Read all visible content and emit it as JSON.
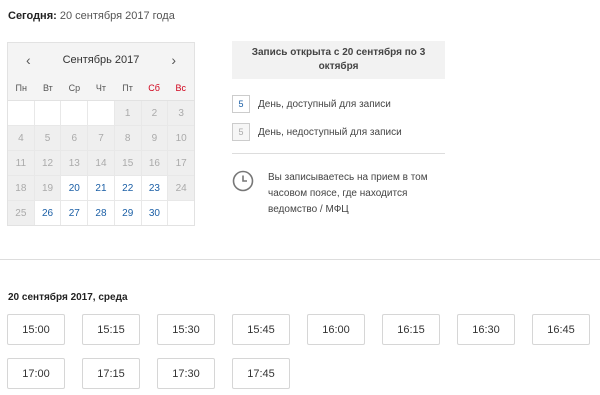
{
  "header": {
    "label": "Сегодня:",
    "date": "20 сентября 2017 года"
  },
  "calendar": {
    "prev_icon": "‹",
    "next_icon": "›",
    "month": "Сентябрь 2017",
    "weekdays": [
      "Пн",
      "Вт",
      "Ср",
      "Чт",
      "Пт",
      "Сб",
      "Вс"
    ],
    "weekend_color": "#d0021b",
    "available_color": "#1b5fa6",
    "days": [
      {
        "d": "",
        "s": "empty"
      },
      {
        "d": "",
        "s": "empty"
      },
      {
        "d": "",
        "s": "empty"
      },
      {
        "d": "",
        "s": "empty"
      },
      {
        "d": "1",
        "s": "na"
      },
      {
        "d": "2",
        "s": "na"
      },
      {
        "d": "3",
        "s": "na"
      },
      {
        "d": "4",
        "s": "na"
      },
      {
        "d": "5",
        "s": "na"
      },
      {
        "d": "6",
        "s": "na"
      },
      {
        "d": "7",
        "s": "na"
      },
      {
        "d": "8",
        "s": "na"
      },
      {
        "d": "9",
        "s": "na"
      },
      {
        "d": "10",
        "s": "na"
      },
      {
        "d": "11",
        "s": "na"
      },
      {
        "d": "12",
        "s": "na"
      },
      {
        "d": "13",
        "s": "na"
      },
      {
        "d": "14",
        "s": "na"
      },
      {
        "d": "15",
        "s": "na"
      },
      {
        "d": "16",
        "s": "na"
      },
      {
        "d": "17",
        "s": "na"
      },
      {
        "d": "18",
        "s": "na"
      },
      {
        "d": "19",
        "s": "na"
      },
      {
        "d": "20",
        "s": "av"
      },
      {
        "d": "21",
        "s": "av"
      },
      {
        "d": "22",
        "s": "av"
      },
      {
        "d": "23",
        "s": "av"
      },
      {
        "d": "24",
        "s": "na"
      },
      {
        "d": "25",
        "s": "na"
      },
      {
        "d": "26",
        "s": "av"
      },
      {
        "d": "27",
        "s": "av"
      },
      {
        "d": "28",
        "s": "av"
      },
      {
        "d": "29",
        "s": "av"
      },
      {
        "d": "30",
        "s": "av"
      },
      {
        "d": "",
        "s": "empty"
      }
    ]
  },
  "notice": "Запись открыта с 20 сентября по 3 октября",
  "legend": {
    "available_num": "5",
    "available_label": "День, доступный для записи",
    "unavailable_num": "5",
    "unavailable_label": "День, недоступный для записи"
  },
  "timezone": {
    "icon": "clock-icon",
    "text": "Вы записываетесь на прием в том часовом поясе, где находится ведомство / МФЦ"
  },
  "selected_date": "20 сентября 2017, среда",
  "slots": [
    "15:00",
    "15:15",
    "15:30",
    "15:45",
    "16:00",
    "16:15",
    "16:30",
    "16:45",
    "17:00",
    "17:15",
    "17:30",
    "17:45"
  ]
}
